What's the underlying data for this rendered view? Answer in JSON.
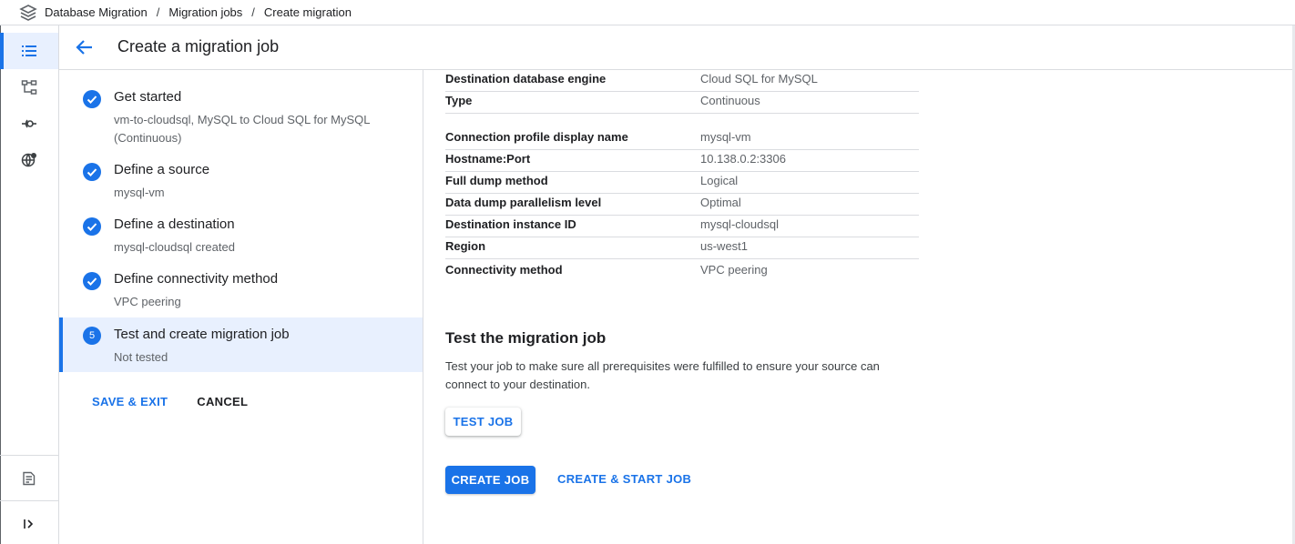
{
  "breadcrumb": {
    "app": "Database Migration",
    "section": "Migration jobs",
    "current": "Create migration"
  },
  "header": {
    "title": "Create a migration job"
  },
  "rail": {
    "items": [
      {
        "icon": "list-icon",
        "active": true
      },
      {
        "icon": "connection-profiles-icon",
        "active": false
      },
      {
        "icon": "private-connectivity-icon",
        "active": false
      },
      {
        "icon": "network-globe-icon",
        "active": false
      }
    ],
    "bottom_items": [
      {
        "icon": "release-notes-icon"
      },
      {
        "icon": "expand-menu-icon"
      }
    ]
  },
  "steps": [
    {
      "title": "Get started",
      "desc": "vm-to-cloudsql, MySQL to Cloud SQL for MySQL (Continuous)",
      "status": "complete"
    },
    {
      "title": "Define a source",
      "desc": "mysql-vm",
      "status": "complete"
    },
    {
      "title": "Define a destination",
      "desc": "mysql-cloudsql created",
      "status": "complete"
    },
    {
      "title": "Define connectivity method",
      "desc": "VPC peering",
      "status": "complete"
    },
    {
      "title": "Test and create migration job",
      "desc": "Not tested",
      "status": "active",
      "number": "5"
    }
  ],
  "step_actions": {
    "save_exit": "SAVE & EXIT",
    "cancel": "CANCEL"
  },
  "summary": [
    {
      "key": "Destination database engine",
      "value": "Cloud SQL for MySQL"
    },
    {
      "key": "Type",
      "value": "Continuous"
    },
    {
      "key": "Connection profile display name",
      "value": "mysql-vm"
    },
    {
      "key": "Hostname:Port",
      "value": "10.138.0.2:3306"
    },
    {
      "key": "Full dump method",
      "value": "Logical"
    },
    {
      "key": "Data dump parallelism level",
      "value": "Optimal"
    },
    {
      "key": "Destination instance ID",
      "value": "mysql-cloudsql"
    },
    {
      "key": "Region",
      "value": "us-west1"
    },
    {
      "key": "Connectivity method",
      "value": "VPC peering"
    }
  ],
  "test_section": {
    "title": "Test the migration job",
    "description": "Test your job to make sure all prerequisites were fulfilled to ensure your source can connect to your destination.",
    "test_button": "TEST JOB"
  },
  "actions": {
    "create_job": "CREATE JOB",
    "create_start_job": "CREATE & START JOB"
  },
  "colors": {
    "accent": "#1a73e8",
    "active_bg": "#e8f0fe",
    "border": "#dadce0"
  }
}
